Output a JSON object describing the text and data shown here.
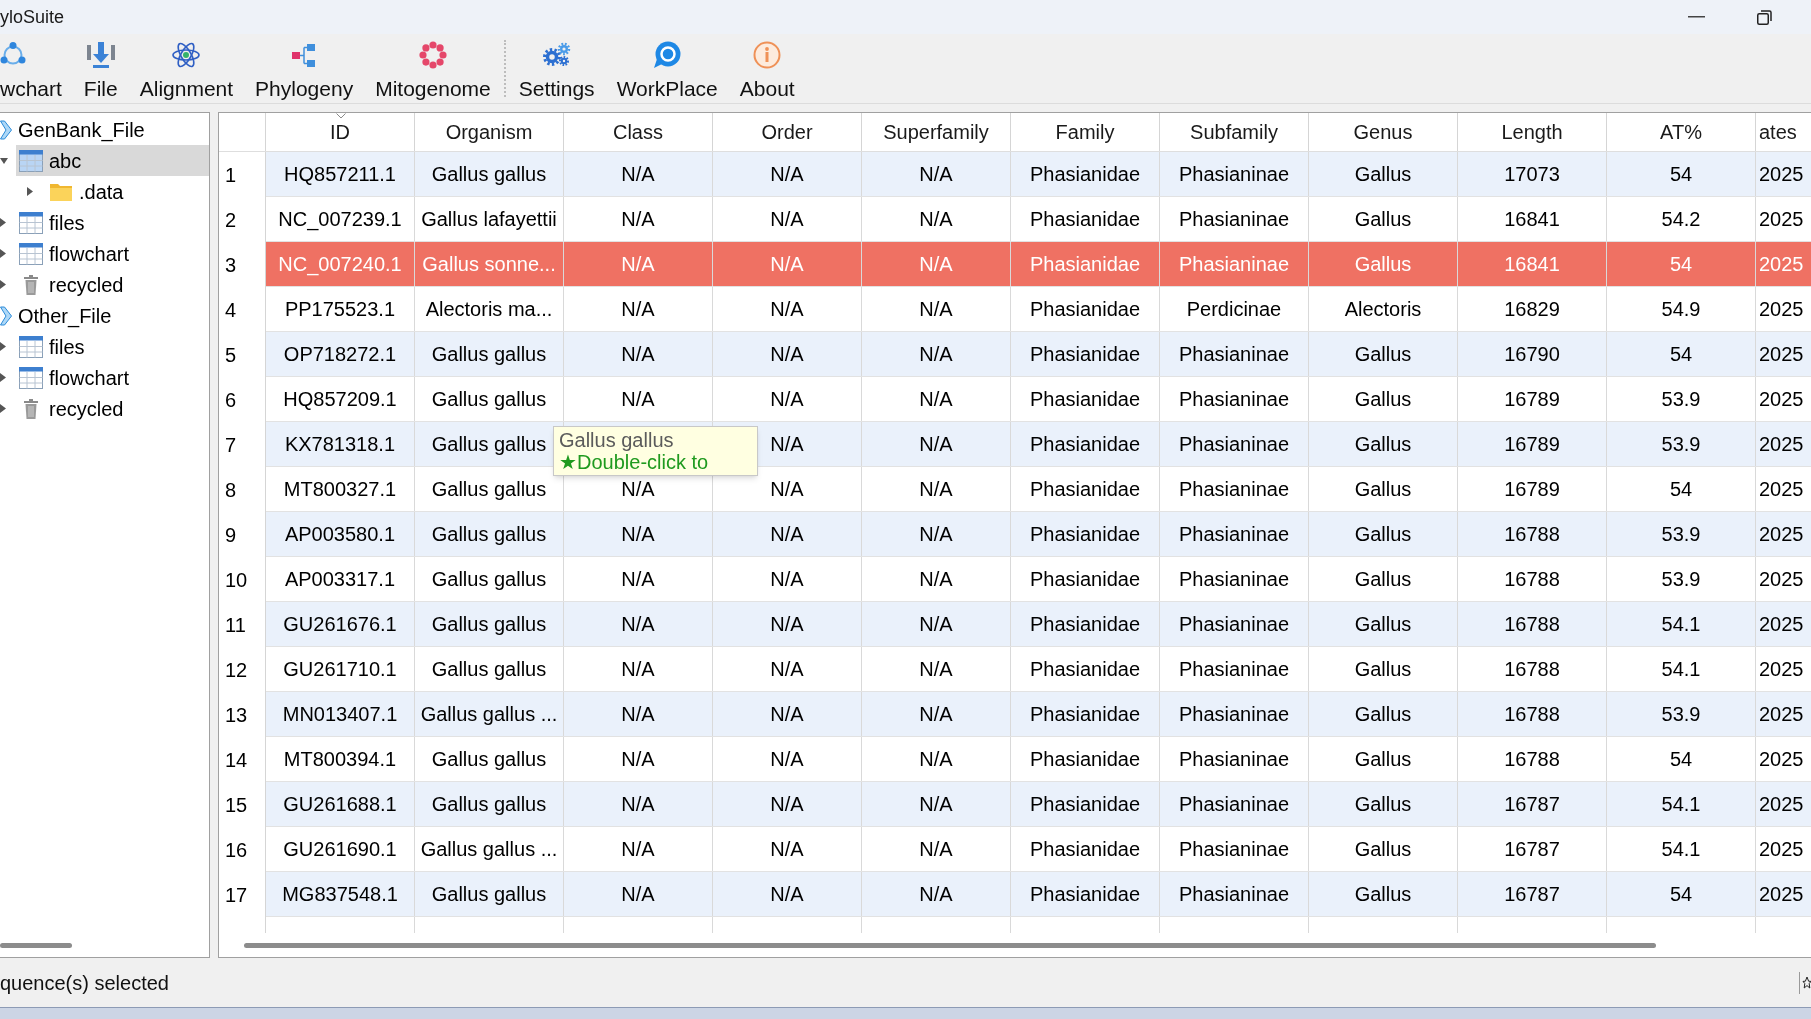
{
  "window": {
    "title": "yloSuite"
  },
  "toolbar": {
    "groups": [
      [
        {
          "label": "wchart"
        },
        {
          "label": "File"
        },
        {
          "label": "Alignment"
        },
        {
          "label": "Phylogeny"
        },
        {
          "label": "Mitogenome"
        }
      ],
      [
        {
          "label": "Settings"
        },
        {
          "label": "WorkPlace"
        },
        {
          "label": "About"
        }
      ]
    ]
  },
  "sidebar": {
    "tree": [
      {
        "label": "GenBank_File",
        "kind": "root",
        "selected": false,
        "children": [
          {
            "label": "abc",
            "kind": "table",
            "selected": true,
            "expanded": true,
            "children": [
              {
                "label": ".data",
                "kind": "folder",
                "selected": false,
                "expanded": false
              }
            ]
          },
          {
            "label": "files",
            "kind": "table",
            "selected": false,
            "expanded": false
          },
          {
            "label": "flowchart",
            "kind": "table",
            "selected": false,
            "expanded": false
          },
          {
            "label": "recycled",
            "kind": "trash",
            "selected": false,
            "expanded": false
          }
        ]
      },
      {
        "label": "Other_File",
        "kind": "root",
        "selected": false,
        "children": [
          {
            "label": "files",
            "kind": "table",
            "selected": false,
            "expanded": false
          },
          {
            "label": "flowchart",
            "kind": "table",
            "selected": false,
            "expanded": false
          },
          {
            "label": "recycled",
            "kind": "trash",
            "selected": false,
            "expanded": false
          }
        ]
      }
    ]
  },
  "table": {
    "columns": [
      {
        "label": "ID",
        "sorted": true
      },
      {
        "label": "Organism",
        "sorted": false
      },
      {
        "label": "Class",
        "sorted": false
      },
      {
        "label": "Order",
        "sorted": false
      },
      {
        "label": "Superfamily",
        "sorted": false
      },
      {
        "label": "Family",
        "sorted": false
      },
      {
        "label": "Subfamily",
        "sorted": false
      },
      {
        "label": "Genus",
        "sorted": false
      },
      {
        "label": "Length",
        "sorted": false
      },
      {
        "label": "AT%",
        "sorted": false
      },
      {
        "label": "ates",
        "sorted": false
      }
    ],
    "rows": [
      {
        "number": "1",
        "selected": false,
        "cells": [
          "HQ857211.1",
          "Gallus gallus",
          "N/A",
          "N/A",
          "N/A",
          "Phasianidae",
          "Phasianinae",
          "Gallus",
          "17073",
          "54",
          "2025"
        ]
      },
      {
        "number": "2",
        "selected": false,
        "cells": [
          "NC_007239.1",
          "Gallus lafayettii",
          "N/A",
          "N/A",
          "N/A",
          "Phasianidae",
          "Phasianinae",
          "Gallus",
          "16841",
          "54.2",
          "2025"
        ]
      },
      {
        "number": "3",
        "selected": true,
        "cells": [
          "NC_007240.1",
          "Gallus sonne...",
          "N/A",
          "N/A",
          "N/A",
          "Phasianidae",
          "Phasianinae",
          "Gallus",
          "16841",
          "54",
          "2025"
        ]
      },
      {
        "number": "4",
        "selected": false,
        "cells": [
          "PP175523.1",
          "Alectoris ma...",
          "N/A",
          "N/A",
          "N/A",
          "Phasianidae",
          "Perdicinae",
          "Alectoris",
          "16829",
          "54.9",
          "2025"
        ]
      },
      {
        "number": "5",
        "selected": false,
        "cells": [
          "OP718272.1",
          "Gallus gallus",
          "N/A",
          "N/A",
          "N/A",
          "Phasianidae",
          "Phasianinae",
          "Gallus",
          "16790",
          "54",
          "2025"
        ]
      },
      {
        "number": "6",
        "selected": false,
        "cells": [
          "HQ857209.1",
          "Gallus gallus",
          "N/A",
          "N/A",
          "N/A",
          "Phasianidae",
          "Phasianinae",
          "Gallus",
          "16789",
          "53.9",
          "2025"
        ]
      },
      {
        "number": "7",
        "selected": false,
        "cells": [
          "KX781318.1",
          "Gallus gallus",
          null,
          "N/A",
          "N/A",
          "Phasianidae",
          "Phasianinae",
          "Gallus",
          "16789",
          "53.9",
          "2025"
        ]
      },
      {
        "number": "8",
        "selected": false,
        "cells": [
          "MT800327.1",
          "Gallus gallus",
          "N/A",
          "N/A",
          "N/A",
          "Phasianidae",
          "Phasianinae",
          "Gallus",
          "16789",
          "54",
          "2025"
        ]
      },
      {
        "number": "9",
        "selected": false,
        "cells": [
          "AP003580.1",
          "Gallus gallus",
          "N/A",
          "N/A",
          "N/A",
          "Phasianidae",
          "Phasianinae",
          "Gallus",
          "16788",
          "53.9",
          "2025"
        ]
      },
      {
        "number": "10",
        "selected": false,
        "cells": [
          "AP003317.1",
          "Gallus gallus",
          "N/A",
          "N/A",
          "N/A",
          "Phasianidae",
          "Phasianinae",
          "Gallus",
          "16788",
          "53.9",
          "2025"
        ]
      },
      {
        "number": "11",
        "selected": false,
        "cells": [
          "GU261676.1",
          "Gallus gallus",
          "N/A",
          "N/A",
          "N/A",
          "Phasianidae",
          "Phasianinae",
          "Gallus",
          "16788",
          "54.1",
          "2025"
        ]
      },
      {
        "number": "12",
        "selected": false,
        "cells": [
          "GU261710.1",
          "Gallus gallus",
          "N/A",
          "N/A",
          "N/A",
          "Phasianidae",
          "Phasianinae",
          "Gallus",
          "16788",
          "54.1",
          "2025"
        ]
      },
      {
        "number": "13",
        "selected": false,
        "cells": [
          "MN013407.1",
          "Gallus gallus ...",
          "N/A",
          "N/A",
          "N/A",
          "Phasianidae",
          "Phasianinae",
          "Gallus",
          "16788",
          "53.9",
          "2025"
        ]
      },
      {
        "number": "14",
        "selected": false,
        "cells": [
          "MT800394.1",
          "Gallus gallus",
          "N/A",
          "N/A",
          "N/A",
          "Phasianidae",
          "Phasianinae",
          "Gallus",
          "16788",
          "54",
          "2025"
        ]
      },
      {
        "number": "15",
        "selected": false,
        "cells": [
          "GU261688.1",
          "Gallus gallus",
          "N/A",
          "N/A",
          "N/A",
          "Phasianidae",
          "Phasianinae",
          "Gallus",
          "16787",
          "54.1",
          "2025"
        ]
      },
      {
        "number": "16",
        "selected": false,
        "cells": [
          "GU261690.1",
          "Gallus gallus ...",
          "N/A",
          "N/A",
          "N/A",
          "Phasianidae",
          "Phasianinae",
          "Gallus",
          "16787",
          "54.1",
          "2025"
        ]
      },
      {
        "number": "17",
        "selected": false,
        "cells": [
          "MG837548.1",
          "Gallus gallus",
          "N/A",
          "N/A",
          "N/A",
          "Phasianidae",
          "Phasianinae",
          "Gallus",
          "16787",
          "54",
          "2025"
        ]
      }
    ]
  },
  "tooltip": {
    "title": "Gallus gallus",
    "hint": "★Double-click to"
  },
  "status_bar": {
    "text": "quence(s) selected"
  }
}
